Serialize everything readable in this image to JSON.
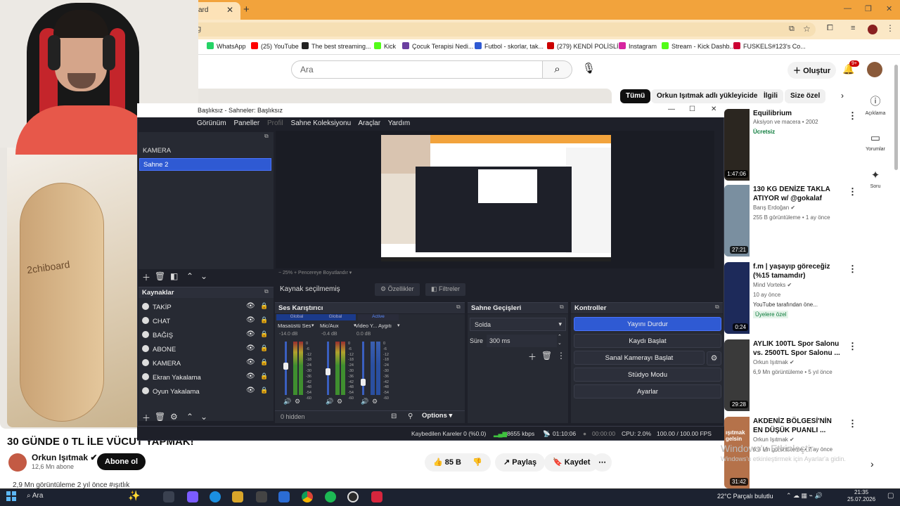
{
  "browser": {
    "tab_label": "ard",
    "address": "g",
    "bookmarks": [
      "WhatsApp",
      "(25) YouTube",
      "The best streaming...",
      "Kick",
      "Çocuk Terapisi Nedi...",
      "Futbol - skorlar, tak...",
      "(279) KENDİ POLİSLİ...",
      "Instagram",
      "Stream - Kick Dashb...",
      "FUSKELS#123's Co..."
    ],
    "bookmark_colors": [
      "#25d366",
      "#ff0000",
      "#222222",
      "#53fc18",
      "#6b3fa0",
      "#2f5ad3",
      "#cc0000",
      "#d6249f",
      "#53fc18",
      "#cc0033"
    ]
  },
  "youtube": {
    "search_placeholder": "Ara",
    "create_label": "Oluştur",
    "notif_badge": "9+",
    "chips": [
      "Tümü",
      "Orkun Işıtmak adlı yükleyiciden",
      "İlgili",
      "Size özel"
    ],
    "side_buttons": [
      {
        "icon": "ⓘ",
        "label": "Açıklama"
      },
      {
        "icon": "▭",
        "label": "Yorumlar"
      },
      {
        "icon": "✦",
        "label": "Soru"
      }
    ],
    "recommendations": [
      {
        "title": "Equilibrium",
        "meta1": "Aksiyon ve macera • 2002",
        "meta2": "Ücretsiz",
        "duration": "1:47:06",
        "color": "#2b2620"
      },
      {
        "title": "130 KG DENİZE TAKLA ATIYOR w/ @gokalaf",
        "meta1": "Barış Erdoğan ✔",
        "meta2": "255 B görüntüleme • 1 ay önce",
        "duration": "27:21",
        "color": "#7a8fa0"
      },
      {
        "title": "f.m | yaşayıp göreceğiz (%15 tamamdır)",
        "meta1": "Mind Vorteks ✔",
        "meta2": "10 ay önce",
        "meta3": "YouTube tarafından öne...",
        "badge": "Üyelere özel",
        "duration": "0:24",
        "color": "#1d2a5a"
      },
      {
        "title": "AYLIK 100TL Spor Salonu vs. 2500TL Spor Salonu ...",
        "meta1": "Orkun Işıtmak ✔",
        "meta2": "6,9 Mn görüntüleme • 5 yıl önce",
        "duration": "29:28",
        "color": "#3a3a3a"
      },
      {
        "title": "AKDENİZ BÖLGESİ'NİN EN DÜŞÜK PUANLI ...",
        "meta1": "Orkun Işıtmak ✔",
        "meta2": "6,3 Mn görüntüleme • 7 ay önce",
        "duration": "31:42",
        "thumb_text": "ışıtmak gelsin",
        "color": "#b5724a"
      }
    ],
    "video_title": "30 GÜNDE 0 TL İLE VÜCUT YAPMAK!",
    "channel_name": "Orkun Işıtmak ✔",
    "channel_subs": "12,6 Mn abone",
    "subscribe_label": "Abone ol",
    "like_count": "85 B",
    "share_label": "Paylaş",
    "save_label": "Kaydet",
    "views_line": "2,9 Mn görüntüleme  2 yıl önce  #ışıtlık",
    "board_text": "2chiboard",
    "watermark_title": "Windows'u Etkinleştir",
    "watermark_sub": "Windows'u etkinleştirmek için Ayarlar'a gidin."
  },
  "obs": {
    "title": "Başlıksız - Sahneler: Başlıksız",
    "menu": [
      "Görünüm",
      "Paneller",
      "Profil",
      "Sahne Koleksiyonu",
      "Araçlar",
      "Yardım"
    ],
    "scenes": [
      "KAMERA",
      "Sahne 2"
    ],
    "selected_scene": "Sahne 2",
    "zoom_bar": "−   25%    +   Pencereye Boyutlandır   ▾",
    "no_source": "Kaynak seçilmemiş",
    "properties_label": "Özellikler",
    "filters_label": "Filtreler",
    "sources_title": "Kaynaklar",
    "sources": [
      "TAKİP",
      "CHAT",
      "BAĞIŞ",
      "ABONE",
      "KAMERA",
      "Ekran Yakalama",
      "Oyun Yakalama"
    ],
    "mixer_title": "Ses Karıştırıcı",
    "mixer_tags": [
      "Global",
      "Global",
      "Active"
    ],
    "mixer_channels": [
      {
        "name": "Masaüstü Ses",
        "db": "-14.0 dB",
        "level": 0.55
      },
      {
        "name": "Mic/Aux",
        "db": "-0.4 dB",
        "level": 0.45
      },
      {
        "name": "Video Y... Aygıtı",
        "db": "0.0 dB",
        "level": 0.25
      }
    ],
    "mixer_scale": [
      "0",
      "-6",
      "-12",
      "-18",
      "-24",
      "-30",
      "-36",
      "-42",
      "-48",
      "-54",
      "-60"
    ],
    "hidden_label": "0 hidden",
    "options_label": "Options",
    "transitions_title": "Sahne Geçişleri",
    "transition": "Solda",
    "duration_label": "Süre",
    "duration_value": "300 ms",
    "controls_title": "Kontroller",
    "controls": [
      "Yayını Durdur",
      "Kaydı Başlat",
      "Sanal Kamerayı Başlat",
      "Stüdyo Modu",
      "Ayarlar"
    ],
    "status": {
      "dropped": "Kaybedilen Kareler 0 (%0.0)",
      "bitrate": "8655 kbps",
      "stream_time": "01:10:06",
      "rec_time": "00:00:00",
      "cpu": "CPU: 2.0%",
      "fps": "100.00 / 100.00 FPS"
    }
  },
  "taskbar": {
    "search": "Ara",
    "weather": "22°C  Parçalı bulutlu",
    "time": "21:35",
    "date": "25.07.2026"
  }
}
